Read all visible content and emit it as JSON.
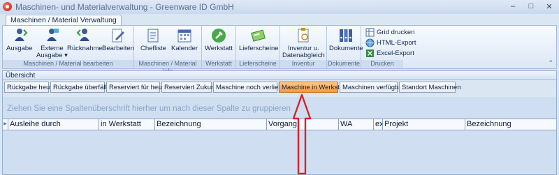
{
  "window": {
    "title": "Maschinen- und Materialverwaltung - Greenware ID GmbH"
  },
  "ribbon": {
    "tab": "Maschinen / Material Verwaltung",
    "groups": [
      {
        "caption": "Maschinen / Material  bearbeiten",
        "buttons": [
          "Ausgabe",
          "Externe Ausgabe",
          "Rücknahme",
          "Bearbeiten"
        ]
      },
      {
        "caption": "Maschinen / Material  Info",
        "buttons": [
          "Chefliste",
          "Kalender"
        ]
      },
      {
        "caption": "Werkstatt",
        "buttons": [
          "Werkstatt"
        ]
      },
      {
        "caption": "Lieferscheine",
        "buttons": [
          "Lieferscheine"
        ]
      },
      {
        "caption": "Inventur",
        "buttons": [
          "Inventur u. Datenabgleich"
        ]
      },
      {
        "caption": "Dokumente",
        "buttons": [
          "Dokumente"
        ]
      },
      {
        "caption": "Drucken",
        "buttons": [
          "Grid drucken",
          "HTML-Export",
          "Excel-Export"
        ]
      }
    ],
    "btn": {
      "ausgabe": "Ausgabe",
      "externe_1": "Externe",
      "externe_2": "Ausgabe",
      "ruecknahme": "Rücknahme",
      "bearbeiten": "Bearbeiten",
      "chefliste": "Chefliste",
      "kalender": "Kalender",
      "werkstatt": "Werkstatt",
      "lieferscheine": "Lieferscheine",
      "inventur_1": "Inventur u.",
      "inventur_2": "Datenabgleich",
      "dokumente": "Dokumente",
      "grid_drucken": "Grid drucken",
      "html_export": "HTML-Export",
      "excel_export": "Excel-Export"
    },
    "cap": {
      "g1": "Maschinen / Material  bearbeiten",
      "g2": "Maschinen / Material  Info",
      "g3": "Werkstatt",
      "g4": "Lieferscheine",
      "g5": "Inventur",
      "g6": "Dokumente",
      "g7": "Drucken"
    }
  },
  "overview": {
    "header": "Übersicht",
    "filters": [
      "Rückgabe heute",
      "Rückgabe überfällig",
      "Reserviert für heute",
      "Reserviert Zukunft",
      "Maschine noch verliehen",
      "Maschine in Werkstatt",
      "Maschinen verfügbar",
      "Standort Maschinen"
    ],
    "active_filter": "Maschine in Werkstatt",
    "group_hint": "Ziehen Sie eine Spaltenüberschrift hierher um nach dieser Spalte zu gruppieren",
    "columns": [
      "Ausleihe durch",
      "in Werkstatt",
      "Bezeichnung",
      "Vorgang",
      "WA",
      "ex",
      "Projekt",
      "Bezeichnung"
    ]
  },
  "colors": {
    "active_filter": "#f39a3a",
    "annotation_arrow": "#d8232a"
  }
}
